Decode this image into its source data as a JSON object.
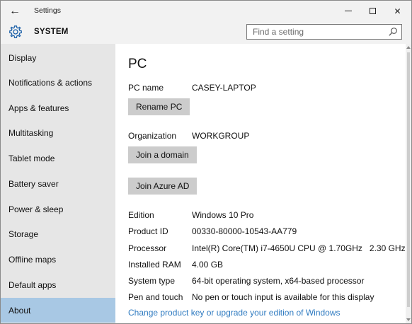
{
  "titlebar": {
    "title": "Settings",
    "back_icon": "←",
    "close_icon": "✕"
  },
  "header": {
    "section": "SYSTEM",
    "search_placeholder": "Find a setting"
  },
  "sidebar": {
    "items": [
      {
        "label": "Display"
      },
      {
        "label": "Notifications & actions"
      },
      {
        "label": "Apps & features"
      },
      {
        "label": "Multitasking"
      },
      {
        "label": "Tablet mode"
      },
      {
        "label": "Battery saver"
      },
      {
        "label": "Power & sleep"
      },
      {
        "label": "Storage"
      },
      {
        "label": "Offline maps"
      },
      {
        "label": "Default apps"
      },
      {
        "label": "About",
        "active": true
      }
    ]
  },
  "main": {
    "heading": "PC",
    "pc_name_label": "PC name",
    "pc_name_value": "CASEY-LAPTOP",
    "rename_button": "Rename PC",
    "org_label": "Organization",
    "org_value": "WORKGROUP",
    "join_domain_button": "Join a domain",
    "join_azure_button": "Join Azure AD",
    "specs": [
      {
        "label": "Edition",
        "value": "Windows 10 Pro"
      },
      {
        "label": "Product ID",
        "value": "00330-80000-10543-AA779"
      },
      {
        "label": "Processor",
        "value": "Intel(R) Core(TM) i7-4650U CPU @ 1.70GHz   2.30 GHz"
      },
      {
        "label": "Installed RAM",
        "value": "4.00 GB"
      },
      {
        "label": "System type",
        "value": "64-bit operating system, x64-based processor"
      },
      {
        "label": "Pen and touch",
        "value": "No pen or touch input is available for this display"
      }
    ],
    "link_text": "Change product key or upgrade your edition of Windows"
  },
  "colors": {
    "accent_link": "#2f7bc1",
    "active_nav": "#a8c8e4",
    "sidebar_bg": "#e6e6e6",
    "button_bg": "#cccccc"
  },
  "icons": {
    "back": "back-arrow-icon",
    "gear": "gear-icon",
    "search": "search-icon",
    "minimize": "minimize-icon",
    "maximize": "maximize-icon",
    "close": "close-icon"
  }
}
